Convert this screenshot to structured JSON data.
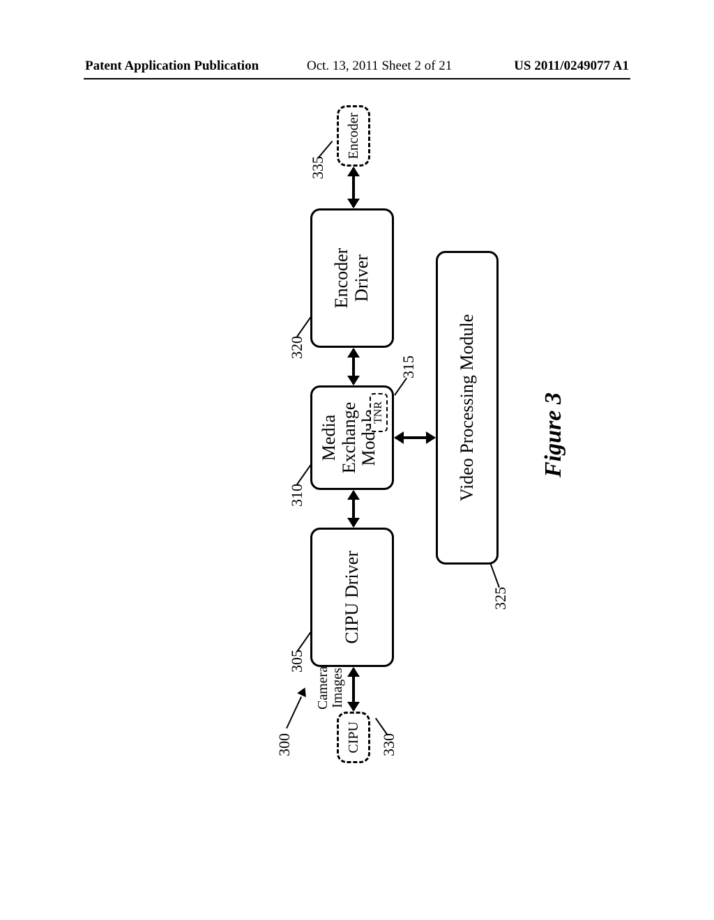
{
  "header": {
    "left": "Patent Application Publication",
    "middle": "Oct. 13, 2011  Sheet 2 of 21",
    "right": "US 2011/0249077 A1"
  },
  "refs": {
    "system": "300",
    "cipu_driver": "305",
    "media_exch": "310",
    "tnr": "315",
    "encoder_driver": "320",
    "video_proc": "325",
    "cipu": "330",
    "encoder": "335"
  },
  "boxes": {
    "cipu": "CIPU",
    "cipu_driver": "CIPU Driver",
    "media_exch_l1": "Media",
    "media_exch_l2": "Exchange",
    "media_exch_l3": "Module",
    "tnr": "TNR",
    "encoder_driver_l1": "Encoder",
    "encoder_driver_l2": "Driver",
    "encoder": "Encoder",
    "video_proc": "Video Processing Module"
  },
  "labels": {
    "camera_images_l1": "Camera",
    "camera_images_l2": "Images"
  },
  "figure_caption": "Figure 3"
}
